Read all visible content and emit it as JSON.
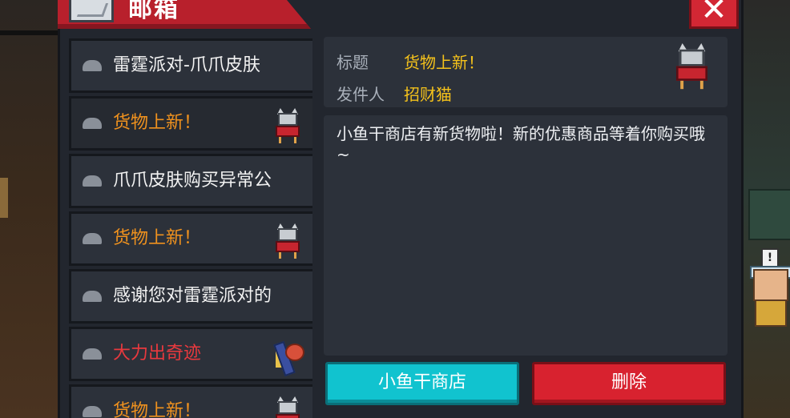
{
  "window": {
    "title": "邮箱",
    "close_label": "✕"
  },
  "mail_list": [
    {
      "subject": "雷霆派对-爪爪皮肤",
      "color": "#f2f2f2",
      "thumb": "none"
    },
    {
      "subject": "货物上新！",
      "color": "#f0921e",
      "thumb": "cat"
    },
    {
      "subject": "爪爪皮肤购买异常公",
      "color": "#f2f2f2",
      "thumb": "none"
    },
    {
      "subject": "货物上新！",
      "color": "#f0921e",
      "thumb": "cat"
    },
    {
      "subject": "感谢您对雷霆派对的",
      "color": "#f2f2f2",
      "thumb": "none"
    },
    {
      "subject": "大力出奇迹",
      "color": "#e8393e",
      "thumb": "hammer"
    },
    {
      "subject": "货物上新！",
      "color": "#f0921e",
      "thumb": "cat"
    }
  ],
  "detail": {
    "title_label": "标题",
    "title_value": "货物上新！",
    "sender_label": "发件人",
    "sender_value": "招财猫",
    "body": "小鱼干商店有新货物啦！新的优惠商品等着你购买哦~"
  },
  "buttons": {
    "shop_label": "小鱼干商店",
    "delete_label": "删除"
  }
}
